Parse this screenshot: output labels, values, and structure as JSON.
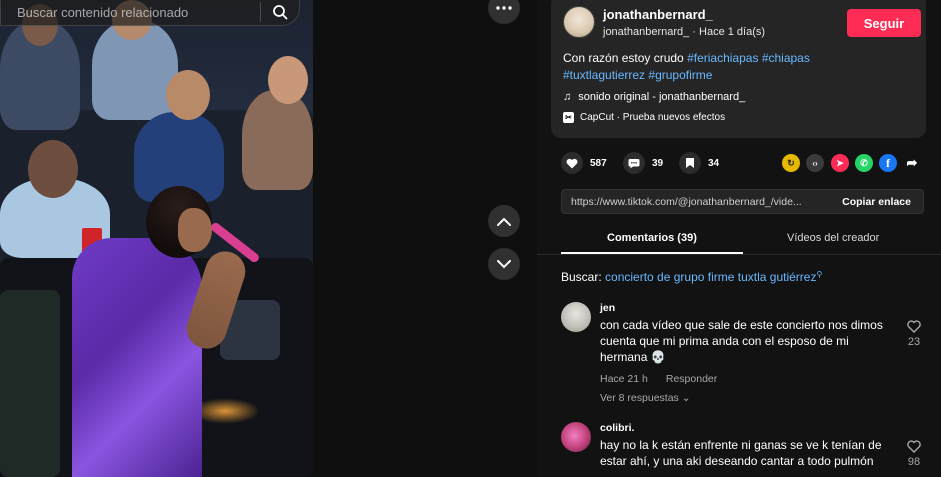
{
  "search": {
    "placeholder": "Buscar contenido relacionado"
  },
  "icons": {
    "search": "search-icon",
    "more": "more-icon",
    "up": "chevron-up-icon",
    "down": "chevron-down-icon",
    "heart": "heart-icon",
    "comment": "comment-icon",
    "bookmark": "bookmark-icon",
    "music": "music-note-icon"
  },
  "colors": {
    "accent": "#fe2c55",
    "hashtag": "#68b8ff",
    "panel": "#252525"
  },
  "post": {
    "username": "jonathanbernard_",
    "handle_time": "jonathanbernard_ · Hace 1 día(s)",
    "follow_label": "Seguir",
    "caption_text": "Con razón estoy crudo",
    "hashtags": [
      "#feriachiapas",
      "#chiapas",
      "#tuxtlagutierrez",
      "#grupofirme"
    ],
    "sound": "sonido original - jonathanbernard_",
    "capcut": "CapCut · Prueba nuevos efectos"
  },
  "stats": {
    "likes": "587",
    "comments": "39",
    "saves": "34"
  },
  "share_targets": [
    "share-circle",
    "embed",
    "direct",
    "whatsapp",
    "facebook",
    "share"
  ],
  "link": {
    "url": "https://www.tiktok.com/@jonathanbernard_/vide...",
    "copy_label": "Copiar enlace"
  },
  "tabs": [
    {
      "label": "Comentarios (39)",
      "active": true
    },
    {
      "label": "Vídeos del creador",
      "active": false
    }
  ],
  "related": {
    "prefix": "Buscar:",
    "query": "concierto de grupo firme tuxtla gutiérrez"
  },
  "comments": [
    {
      "name": "jen",
      "text": "con cada vídeo que sale de este concierto nos dimos cuenta que mi prima anda con el esposo de mi hermana 💀",
      "time": "Hace 21 h",
      "reply_label": "Responder",
      "replies": "Ver 8 respuestas ⌄",
      "likes": "23"
    },
    {
      "name": "colibri.",
      "text": "hay no la k están enfrente ni ganas se ve k tenían de estar ahí, y una aki deseando cantar a todo pulmón",
      "likes": "98"
    }
  ]
}
